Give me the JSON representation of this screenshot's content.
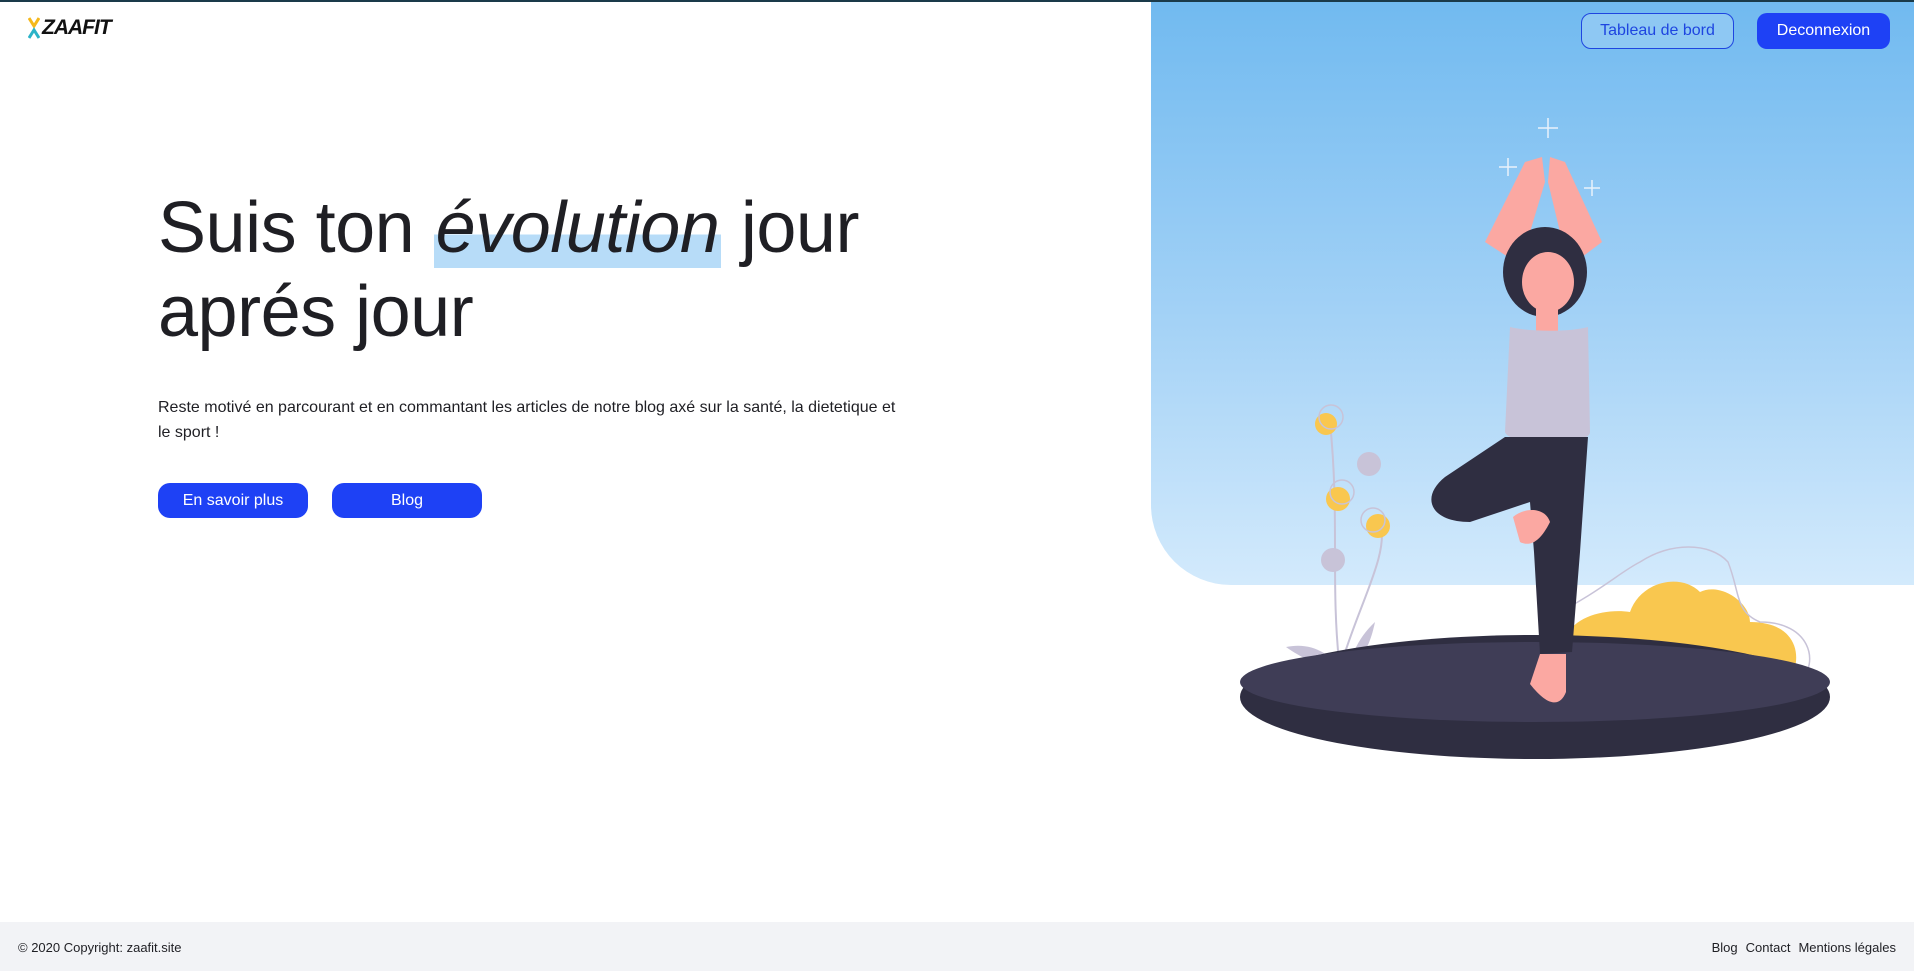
{
  "brand": {
    "name": "ZAAFIT"
  },
  "nav": {
    "dashboard_label": "Tableau de bord",
    "logout_label": "Deconnexion"
  },
  "hero": {
    "title_part1": "Suis ton ",
    "title_highlight": "évolution",
    "title_part2": " jour aprés jour",
    "subtitle": "Reste motivé en parcourant et en commantant les articles de notre blog axé sur la santé, la dietetique et le sport !",
    "cta_primary": "En savoir plus",
    "cta_secondary": "Blog"
  },
  "footer": {
    "copyright": "© 2020 Copyright: zaafit.site",
    "links": [
      "Blog",
      "Contact",
      "Mentions légales"
    ]
  },
  "colors": {
    "accent": "#1e41f5",
    "hero_gradient_top": "#71baf0",
    "hero_gradient_bottom": "#d3eafc",
    "footer_bg": "#f2f3f6"
  },
  "icons": {
    "logo": "zaafit-logo-icon",
    "illustration": "yoga-woman-illustration"
  }
}
